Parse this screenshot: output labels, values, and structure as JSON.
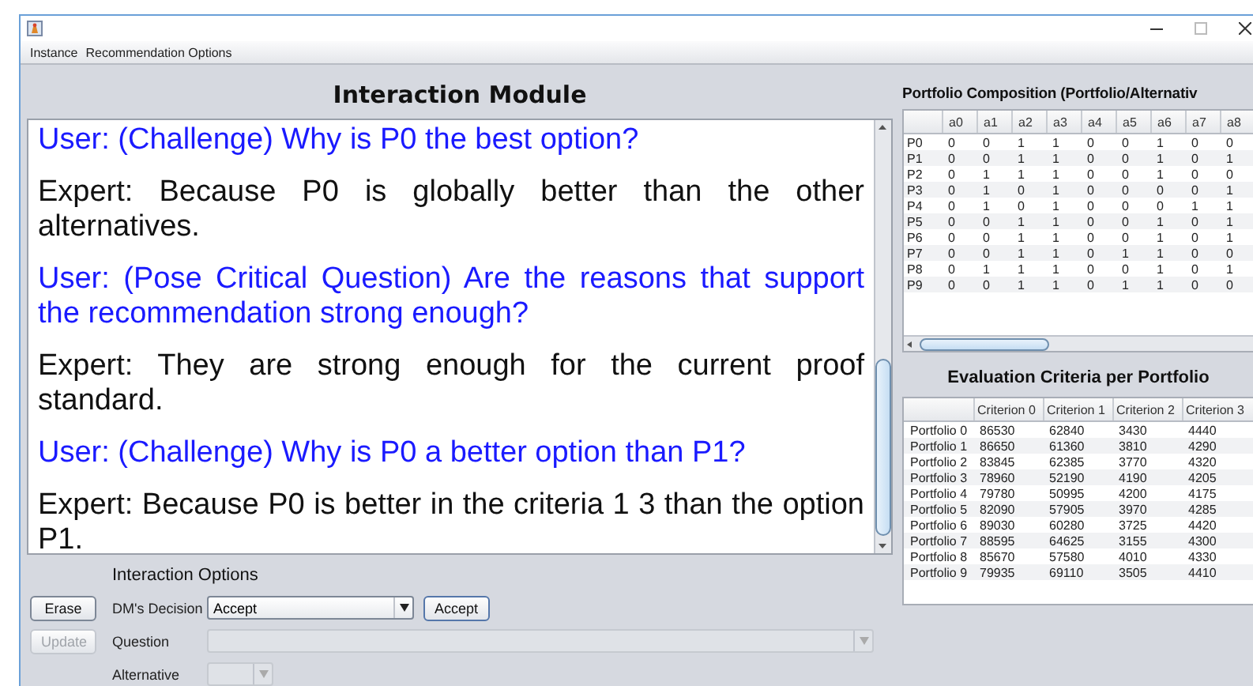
{
  "menu": [
    {
      "label": "Instance"
    },
    {
      "label": "Recommendation Options"
    }
  ],
  "interaction_module": {
    "title": "Interaction Module",
    "messages": [
      {
        "kind": "user",
        "text": "User: (Challenge) Why is P0 the best option?"
      },
      {
        "kind": "expert",
        "text": "Expert: Because P0 is globally better than the other alternatives."
      },
      {
        "kind": "user",
        "text": "User: (Pose Critical Question) Are the reasons that support the recommendation strong enough?"
      },
      {
        "kind": "expert",
        "text": "Expert: They are strong enough for the current proof standard."
      },
      {
        "kind": "user",
        "text": "User: (Challenge) Why is P0 a better option than P1?"
      },
      {
        "kind": "expert",
        "text": "Expert: Because P0 is better in the criteria 1 3 than the option P1."
      }
    ]
  },
  "interaction_options": {
    "title": "Interaction Options",
    "erase_button": {
      "label": "Erase",
      "disabled": false
    },
    "update_button": {
      "label": "Update",
      "disabled": true
    },
    "decision": {
      "label": "DM's Decision",
      "value": "Accept",
      "disabled": false
    },
    "accept_button": {
      "label": "Accept",
      "disabled": false
    },
    "question": {
      "label": "Question",
      "disabled": true
    },
    "alternative": {
      "label": "Alternative",
      "disabled": true
    }
  },
  "portfolio_composition": {
    "title": "Portfolio Composition (Portfolio/Alternativ",
    "columns": [
      "a0",
      "a1",
      "a2",
      "a3",
      "a4",
      "a5",
      "a6",
      "a7",
      "a8"
    ],
    "rows": [
      {
        "label": "P0",
        "values": [
          "0",
          "0",
          "1",
          "1",
          "0",
          "0",
          "1",
          "0",
          "0"
        ]
      },
      {
        "label": "P1",
        "values": [
          "0",
          "0",
          "1",
          "1",
          "0",
          "0",
          "1",
          "0",
          "1"
        ]
      },
      {
        "label": "P2",
        "values": [
          "0",
          "1",
          "1",
          "1",
          "0",
          "0",
          "1",
          "0",
          "0"
        ]
      },
      {
        "label": "P3",
        "values": [
          "0",
          "1",
          "0",
          "1",
          "0",
          "0",
          "0",
          "0",
          "1"
        ]
      },
      {
        "label": "P4",
        "values": [
          "0",
          "1",
          "0",
          "1",
          "0",
          "0",
          "0",
          "1",
          "1"
        ]
      },
      {
        "label": "P5",
        "values": [
          "0",
          "0",
          "1",
          "1",
          "0",
          "0",
          "1",
          "0",
          "1"
        ]
      },
      {
        "label": "P6",
        "values": [
          "0",
          "0",
          "1",
          "1",
          "0",
          "0",
          "1",
          "0",
          "1"
        ]
      },
      {
        "label": "P7",
        "values": [
          "0",
          "0",
          "1",
          "1",
          "0",
          "1",
          "1",
          "0",
          "0"
        ]
      },
      {
        "label": "P8",
        "values": [
          "0",
          "1",
          "1",
          "1",
          "0",
          "0",
          "1",
          "0",
          "1"
        ]
      },
      {
        "label": "P9",
        "values": [
          "0",
          "0",
          "1",
          "1",
          "0",
          "1",
          "1",
          "0",
          "0"
        ]
      }
    ]
  },
  "evaluation_criteria": {
    "title": "Evaluation Criteria per Portfolio",
    "columns": [
      "Criterion 0",
      "Criterion 1",
      "Criterion 2",
      "Criterion 3"
    ],
    "rows": [
      {
        "label": "Portfolio 0",
        "values": [
          "86530",
          "62840",
          "3430",
          "4440"
        ]
      },
      {
        "label": "Portfolio 1",
        "values": [
          "86650",
          "61360",
          "3810",
          "4290"
        ]
      },
      {
        "label": "Portfolio 2",
        "values": [
          "83845",
          "62385",
          "3770",
          "4320"
        ]
      },
      {
        "label": "Portfolio 3",
        "values": [
          "78960",
          "52190",
          "4190",
          "4205"
        ]
      },
      {
        "label": "Portfolio 4",
        "values": [
          "79780",
          "50995",
          "4200",
          "4175"
        ]
      },
      {
        "label": "Portfolio 5",
        "values": [
          "82090",
          "57905",
          "3970",
          "4285"
        ]
      },
      {
        "label": "Portfolio 6",
        "values": [
          "89030",
          "60280",
          "3725",
          "4420"
        ]
      },
      {
        "label": "Portfolio 7",
        "values": [
          "88595",
          "64625",
          "3155",
          "4300"
        ]
      },
      {
        "label": "Portfolio 8",
        "values": [
          "85670",
          "57580",
          "4010",
          "4330"
        ]
      },
      {
        "label": "Portfolio 9",
        "values": [
          "79935",
          "69110",
          "3505",
          "4410"
        ]
      }
    ]
  }
}
